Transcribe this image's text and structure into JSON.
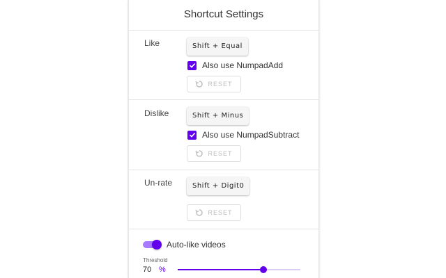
{
  "title": "Shortcut Settings",
  "colors": {
    "accent": "#6200ee",
    "accent_light": "#a77bff",
    "reset_text": "#bdbdbd"
  },
  "shortcuts": [
    {
      "label": "Like",
      "key": "Shift + Equal",
      "alt_checked": true,
      "alt_label": "Also use NumpadAdd",
      "reset_label": "RESET"
    },
    {
      "label": "Dislike",
      "key": "Shift + Minus",
      "alt_checked": true,
      "alt_label": "Also use NumpadSubtract",
      "reset_label": "RESET"
    },
    {
      "label": "Un-rate",
      "key": "Shift + Digit0",
      "reset_label": "RESET"
    }
  ],
  "auto_like": {
    "enabled": true,
    "label": "Auto-like videos"
  },
  "threshold": {
    "label": "Threshold",
    "value": "70",
    "unit": "%",
    "slider_fraction": 0.7
  }
}
